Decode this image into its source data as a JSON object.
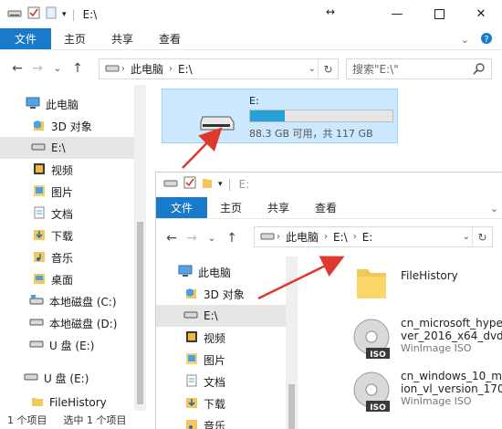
{
  "window1": {
    "title": "E:\\",
    "ribbon": {
      "file": "文件",
      "home": "主页",
      "share": "共享",
      "view": "查看"
    },
    "address": {
      "this_pc": "此电脑",
      "drive": "E:\\"
    },
    "search_placeholder": "搜索\"E:\\\"",
    "sidebar": [
      {
        "label": "此电脑",
        "icon": "pc-icon"
      },
      {
        "label": "3D 对象",
        "icon": "3d-objects-icon"
      },
      {
        "label": "E:\\",
        "icon": "drive-icon",
        "selected": true
      },
      {
        "label": "视频",
        "icon": "video-folder-icon"
      },
      {
        "label": "图片",
        "icon": "pictures-folder-icon"
      },
      {
        "label": "文档",
        "icon": "documents-folder-icon"
      },
      {
        "label": "下载",
        "icon": "downloads-folder-icon"
      },
      {
        "label": "音乐",
        "icon": "music-folder-icon"
      },
      {
        "label": "桌面",
        "icon": "desktop-folder-icon"
      },
      {
        "label": "本地磁盘 (C:)",
        "icon": "drive-c-icon"
      },
      {
        "label": "本地磁盘 (D:)",
        "icon": "drive-icon"
      },
      {
        "label": "U 盘 (E:)",
        "icon": "usb-drive-icon"
      },
      {
        "label": "U 盘 (E:)",
        "icon": "usb-drive-icon"
      },
      {
        "label": "FileHistory",
        "icon": "folder-icon"
      }
    ],
    "drive_tile": {
      "name": "E:",
      "capacity": "88.3 GB 可用，共 117 GB",
      "used_fraction": 0.245
    },
    "status": {
      "count": "1 个项目",
      "selected": "选中 1 个项目"
    }
  },
  "window2": {
    "title": "E:",
    "ribbon": {
      "file": "文件",
      "home": "主页",
      "share": "共享",
      "view": "查看"
    },
    "address": {
      "this_pc": "此电脑",
      "drive": "E:\\",
      "sub": "E:"
    },
    "sidebar": [
      {
        "label": "此电脑",
        "icon": "pc-icon"
      },
      {
        "label": "3D 对象",
        "icon": "3d-objects-icon"
      },
      {
        "label": "E:\\",
        "icon": "drive-icon",
        "selected": true
      },
      {
        "label": "视频",
        "icon": "video-folder-icon"
      },
      {
        "label": "图片",
        "icon": "pictures-folder-icon"
      },
      {
        "label": "文档",
        "icon": "documents-folder-icon"
      },
      {
        "label": "下载",
        "icon": "downloads-folder-icon"
      },
      {
        "label": "音乐",
        "icon": "music-folder-icon"
      }
    ],
    "files": [
      {
        "name": "FileHistory",
        "type": "",
        "icon": "folder-icon"
      },
      {
        "name": "cn_microsoft_hype",
        "name2": "ver_2016_x64_dvd",
        "type": "WinImage ISO",
        "icon": "iso-disc-icon"
      },
      {
        "name": "cn_windows_10_m",
        "name2": "ion_vl_version_170",
        "type": "WinImage ISO",
        "icon": "iso-disc-icon"
      }
    ]
  },
  "colors": {
    "accent": "#1979ca",
    "selection": "#cce8ff",
    "drive_bar": "#26a0da",
    "annotation_arrow": "#e0382c"
  }
}
